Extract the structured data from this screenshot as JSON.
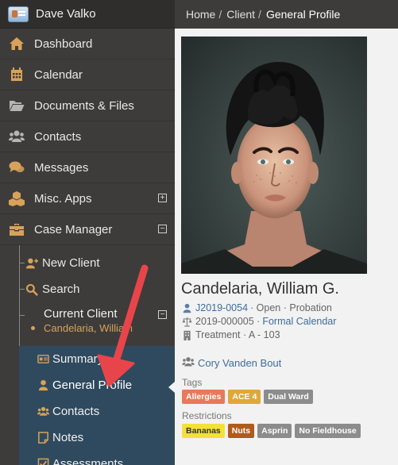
{
  "sidebar": {
    "user_name": "Dave Valko",
    "items": [
      {
        "label": "Dashboard",
        "icon": "home-icon"
      },
      {
        "label": "Calendar",
        "icon": "calendar-icon"
      },
      {
        "label": "Documents & Files",
        "icon": "folder-icon"
      },
      {
        "label": "Contacts",
        "icon": "users-icon"
      },
      {
        "label": "Messages",
        "icon": "chat-icon"
      },
      {
        "label": "Misc. Apps",
        "icon": "cubes-icon",
        "toggle": "+"
      },
      {
        "label": "Case Manager",
        "icon": "briefcase-icon",
        "toggle": "−"
      }
    ],
    "case_manager": {
      "new_client": "New Client",
      "search": "Search",
      "current_client_title": "Current Client",
      "current_client_toggle": "−",
      "current_client_name": "Candelaria, William"
    },
    "client_menu": [
      {
        "label": "Summary",
        "icon": "id-card-icon"
      },
      {
        "label": "General Profile",
        "icon": "user-icon"
      },
      {
        "label": "Contacts",
        "icon": "users-icon"
      },
      {
        "label": "Notes",
        "icon": "note-icon"
      },
      {
        "label": "Assessments",
        "icon": "checkbox-icon"
      }
    ]
  },
  "breadcrumb": {
    "home": "Home",
    "client": "Client",
    "current": "General Profile",
    "separator": "/"
  },
  "profile": {
    "name": "Candelaria, William G.",
    "case_id": "J2019-0054",
    "case_status": "· Open · Probation",
    "court_id": "2019-000005 ·",
    "court_link": "Formal Calendar",
    "location": "Treatment · A - 103",
    "counselor": "Cory Vanden Bout",
    "tags_label": "Tags",
    "tags": [
      {
        "text": "Allergies",
        "color": "#e8795a"
      },
      {
        "text": "ACE 4",
        "color": "#e0a83a"
      },
      {
        "text": "Dual Ward",
        "color": "#8c8c8c"
      }
    ],
    "restrictions_label": "Restrictions",
    "restrictions": [
      {
        "text": "Bananas",
        "color": "#f4e03a",
        "text_color": "#333333"
      },
      {
        "text": "Nuts",
        "color": "#b05a1e",
        "text_color": "#ffffff"
      },
      {
        "text": "Asprin",
        "color": "#8c8c8c",
        "text_color": "#ffffff"
      },
      {
        "text": "No Fieldhouse",
        "color": "#8c8c8c",
        "text_color": "#ffffff"
      }
    ]
  },
  "colors": {
    "sidebar_bg": "#3d3c3a",
    "accent": "#d8a25a",
    "client_panel_bg": "#2f4a5e",
    "link": "#3d6d9e",
    "arrow": "#e8454a"
  }
}
